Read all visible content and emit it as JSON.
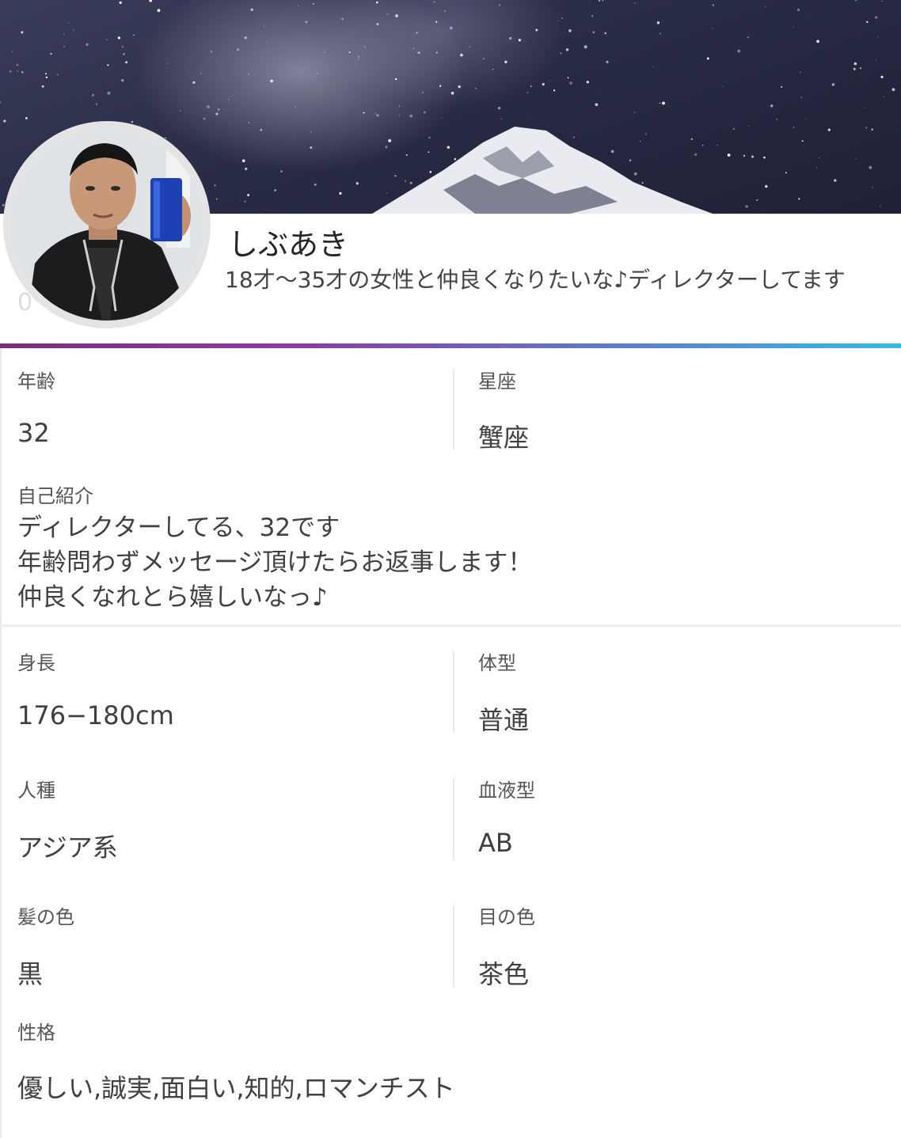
{
  "profile": {
    "name": "しぶあき",
    "tagline": "18才〜35才の女性と仲良くなりたいな♪ディレクターしてます",
    "ghost_count": "0"
  },
  "details": {
    "age": {
      "label": "年齢",
      "value": "32"
    },
    "zodiac": {
      "label": "星座",
      "value": "蟹座"
    },
    "intro": {
      "label": "自己紹介",
      "value": "ディレクターしてる、32です\n年齢問わずメッセージ頂けたらお返事します！\n仲良くなれとら嬉しいなっ♪"
    },
    "height": {
      "label": "身長",
      "value": "176−180cm"
    },
    "body_type": {
      "label": "体型",
      "value": "普通"
    },
    "ethnicity": {
      "label": "人種",
      "value": "アジア系"
    },
    "blood_type": {
      "label": "血液型",
      "value": "AB"
    },
    "hair_color": {
      "label": "髪の色",
      "value": "黒"
    },
    "eye_color": {
      "label": "目の色",
      "value": "茶色"
    },
    "personality": {
      "label": "性格",
      "value": "優しい,誠実,面白い,知的,ロマンチスト"
    }
  },
  "colors": {
    "accent_gradient_start": "#7a2e7e",
    "accent_gradient_end": "#38b8e6"
  }
}
